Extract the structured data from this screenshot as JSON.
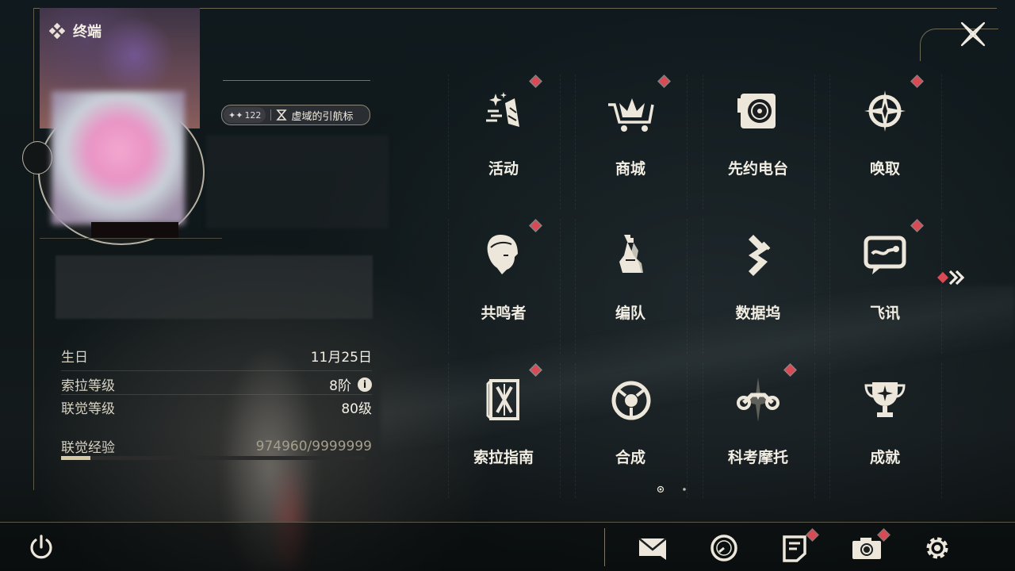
{
  "header": {
    "title": "终端"
  },
  "profile": {
    "world_level": "122",
    "title_badge": "虚域的引航标",
    "info": [
      {
        "label": "生日",
        "value": "11月25日"
      },
      {
        "label": "索拉等级",
        "value": "8阶"
      },
      {
        "label": "联觉等级",
        "value": "80级"
      },
      {
        "label": "联觉经验",
        "value": "974960/9999999"
      }
    ],
    "exp_progress": 0.0975
  },
  "menu": [
    {
      "label": "活动",
      "icon": "activity-icon",
      "badge": true
    },
    {
      "label": "商城",
      "icon": "shop-icon",
      "badge": true
    },
    {
      "label": "先约电台",
      "icon": "radio-icon",
      "badge": false
    },
    {
      "label": "唤取",
      "icon": "convene-icon",
      "badge": true
    },
    {
      "label": "共鸣者",
      "icon": "resonator-icon",
      "badge": true
    },
    {
      "label": "编队",
      "icon": "team-icon",
      "badge": false
    },
    {
      "label": "数据坞",
      "icon": "data-bank-icon",
      "badge": false
    },
    {
      "label": "飞讯",
      "icon": "message-icon",
      "badge": true
    },
    {
      "label": "索拉指南",
      "icon": "guidebook-icon",
      "badge": true
    },
    {
      "label": "合成",
      "icon": "synthesis-icon",
      "badge": false
    },
    {
      "label": "科考摩托",
      "icon": "motorbike-icon",
      "badge": true
    },
    {
      "label": "成就",
      "icon": "achievement-icon",
      "badge": false
    }
  ],
  "pager": {
    "current": 1,
    "total": 2
  },
  "bottom_icons": [
    "power-icon",
    "mail-icon",
    "clock-icon",
    "notice-icon",
    "camera-icon",
    "settings-icon"
  ],
  "colors": {
    "accent": "#d7c9a4",
    "badge_red": "#d94a55",
    "text": "#f2eee3"
  }
}
